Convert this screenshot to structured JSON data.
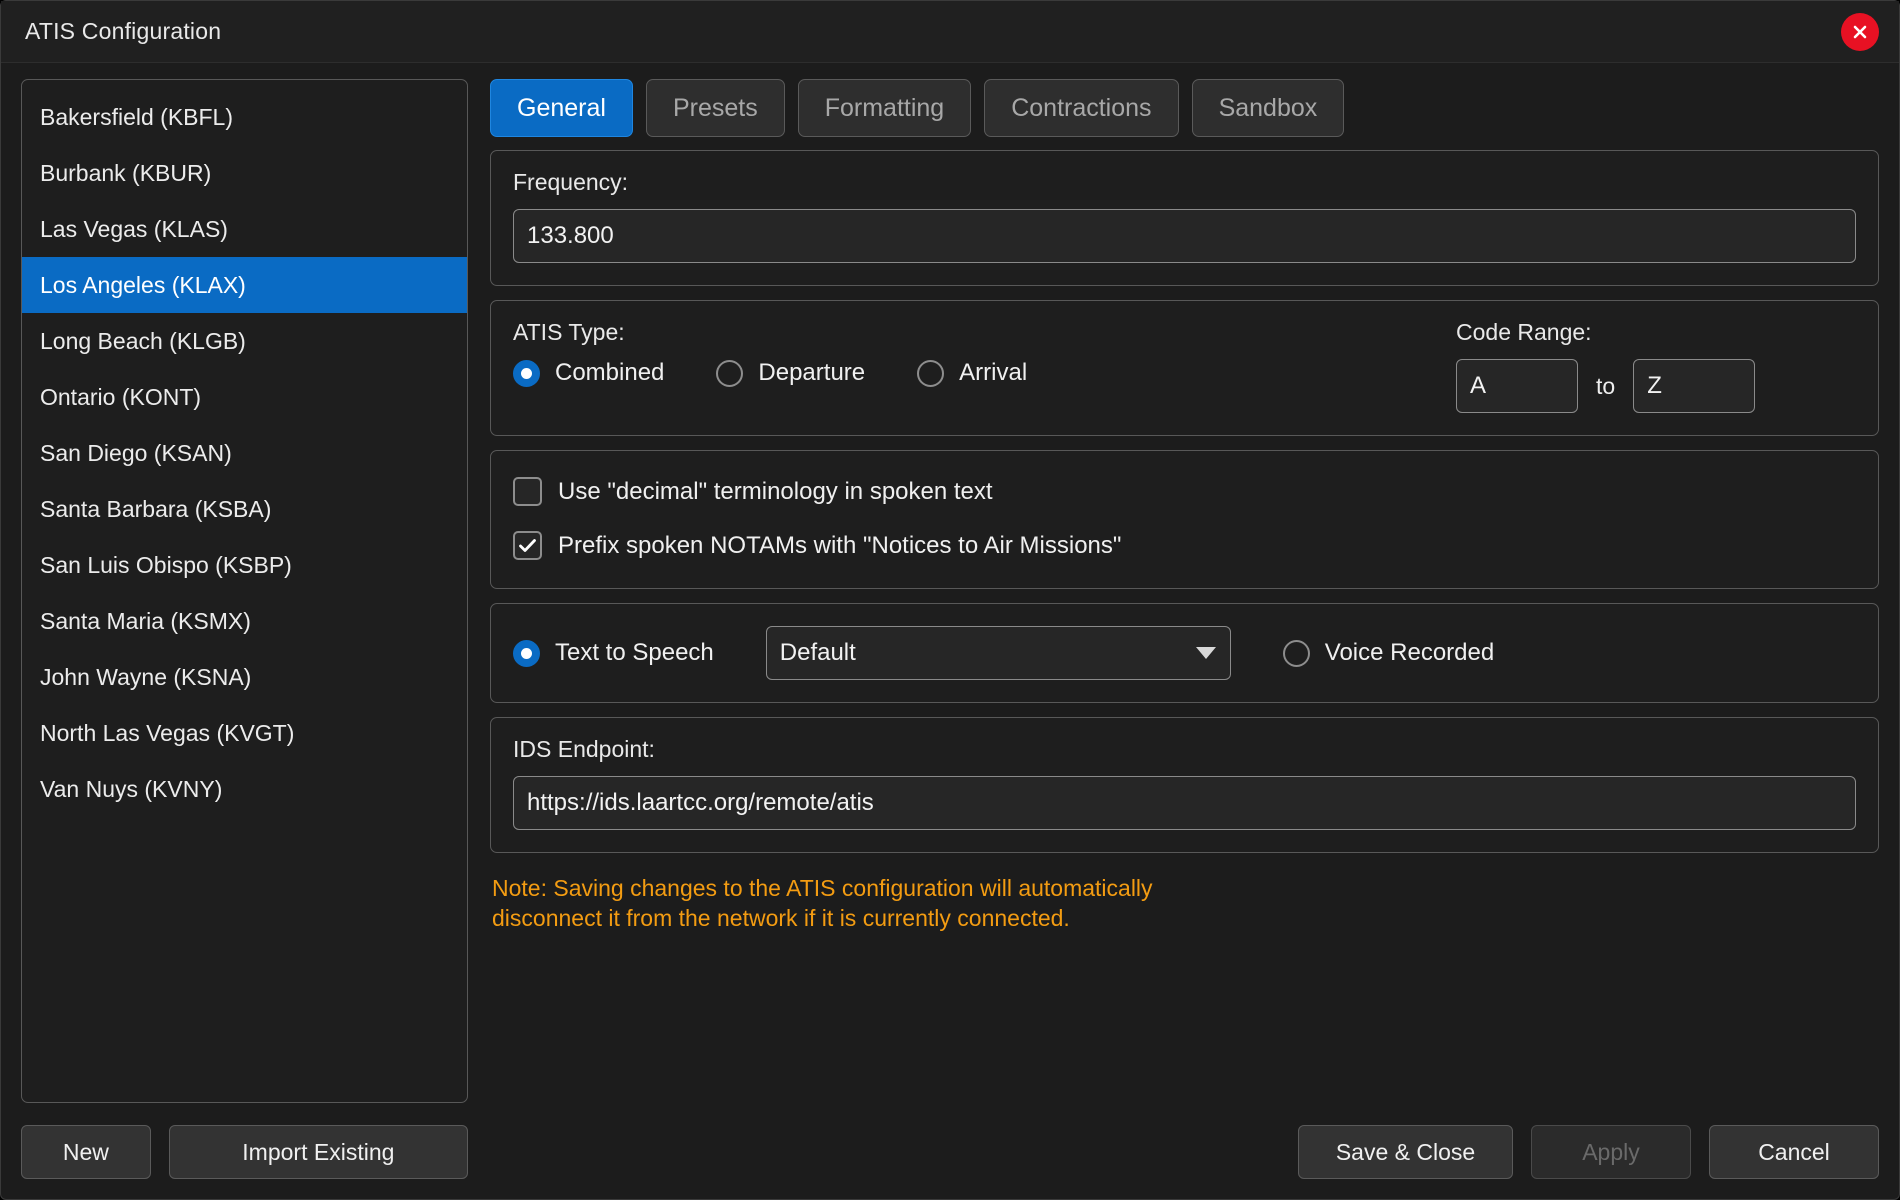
{
  "window": {
    "title": "ATIS Configuration",
    "close_icon": "close-icon",
    "accent_color": "#0a6bc4",
    "note_color": "#f39c12",
    "close_color": "#e81123"
  },
  "sidebar": {
    "items": [
      {
        "label": "Bakersfield (KBFL)",
        "selected": false
      },
      {
        "label": "Burbank (KBUR)",
        "selected": false
      },
      {
        "label": "Las Vegas (KLAS)",
        "selected": false
      },
      {
        "label": "Los Angeles (KLAX)",
        "selected": true
      },
      {
        "label": "Long Beach (KLGB)",
        "selected": false
      },
      {
        "label": "Ontario (KONT)",
        "selected": false
      },
      {
        "label": "San Diego (KSAN)",
        "selected": false
      },
      {
        "label": "Santa Barbara (KSBA)",
        "selected": false
      },
      {
        "label": "San Luis Obispo (KSBP)",
        "selected": false
      },
      {
        "label": "Santa Maria (KSMX)",
        "selected": false
      },
      {
        "label": "John Wayne (KSNA)",
        "selected": false
      },
      {
        "label": "North Las Vegas (KVGT)",
        "selected": false
      },
      {
        "label": "Van Nuys (KVNY)",
        "selected": false
      }
    ],
    "new_label": "New",
    "import_label": "Import Existing"
  },
  "tabs": [
    {
      "label": "General",
      "active": true
    },
    {
      "label": "Presets",
      "active": false
    },
    {
      "label": "Formatting",
      "active": false
    },
    {
      "label": "Contractions",
      "active": false
    },
    {
      "label": "Sandbox",
      "active": false
    }
  ],
  "general": {
    "frequency": {
      "label": "Frequency:",
      "value": "133.800"
    },
    "atis_type": {
      "label": "ATIS Type:",
      "options": [
        {
          "label": "Combined",
          "selected": true
        },
        {
          "label": "Departure",
          "selected": false
        },
        {
          "label": "Arrival",
          "selected": false
        }
      ]
    },
    "code_range": {
      "label": "Code Range:",
      "from": "A",
      "to_label": "to",
      "to": "Z"
    },
    "checkboxes": [
      {
        "label": "Use \"decimal\" terminology in spoken text",
        "checked": false
      },
      {
        "label": "Prefix spoken NOTAMs with \"Notices to Air Missions\"",
        "checked": true
      }
    ],
    "voice": {
      "tts_label": "Text to Speech",
      "tts_selected": true,
      "tts_voice": "Default",
      "recorded_label": "Voice Recorded",
      "recorded_selected": false
    },
    "ids_endpoint": {
      "label": "IDS Endpoint:",
      "value": "https://ids.laartcc.org/remote/atis"
    },
    "note_line1": "Note: Saving changes to the ATIS configuration will automatically",
    "note_line2": "disconnect it from the network if it is currently connected."
  },
  "footer": {
    "save_label": "Save & Close",
    "apply_label": "Apply",
    "cancel_label": "Cancel",
    "apply_disabled": true
  }
}
